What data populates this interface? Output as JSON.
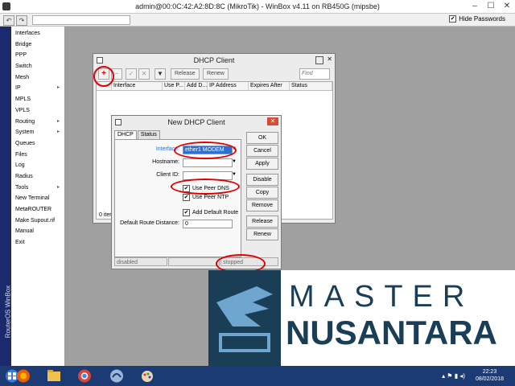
{
  "titlebar": {
    "title": "admin@00:0C:42:A2:8D:8C (MikroTik) - WinBox v4.11 on RB450G (mipsbe)",
    "minimize": "–",
    "maximize": "☐",
    "close": "✕"
  },
  "toolbar": {
    "undo": "↶",
    "redo": "↷",
    "hide_passwords_label": "Hide Passwords",
    "hide_passwords_checked": "✔"
  },
  "sidebar": {
    "brand_vertical": "RouterOS WinBox",
    "items": [
      {
        "label": "Interfaces",
        "arrow": ""
      },
      {
        "label": "Bridge",
        "arrow": ""
      },
      {
        "label": "PPP",
        "arrow": ""
      },
      {
        "label": "Switch",
        "arrow": ""
      },
      {
        "label": "Mesh",
        "arrow": ""
      },
      {
        "label": "IP",
        "arrow": "▸"
      },
      {
        "label": "MPLS",
        "arrow": ""
      },
      {
        "label": "VPLS",
        "arrow": ""
      },
      {
        "label": "Routing",
        "arrow": "▸"
      },
      {
        "label": "System",
        "arrow": "▸"
      },
      {
        "label": "Queues",
        "arrow": ""
      },
      {
        "label": "Files",
        "arrow": ""
      },
      {
        "label": "Log",
        "arrow": ""
      },
      {
        "label": "Radius",
        "arrow": ""
      },
      {
        "label": "Tools",
        "arrow": "▸"
      },
      {
        "label": "New Terminal",
        "arrow": ""
      },
      {
        "label": "MetaROUTER",
        "arrow": ""
      },
      {
        "label": "Make Supout.rif",
        "arrow": ""
      },
      {
        "label": "Manual",
        "arrow": ""
      },
      {
        "label": "Exit",
        "arrow": ""
      }
    ]
  },
  "dhcp_client": {
    "title": "DHCP Client",
    "add": "+",
    "remove": "−",
    "enable": "✓",
    "disable": "✕",
    "filter": "▼",
    "release": "Release",
    "renew": "Renew",
    "find_placeholder": "Find",
    "columns": [
      "Interface",
      "Use P...",
      "Add D...",
      "IP Address",
      "Expires After",
      "Status"
    ],
    "items_count": "0 item"
  },
  "new_dhcp_client": {
    "title": "New DHCP Client",
    "tabs": [
      "DHCP",
      "Status"
    ],
    "interface_label": "Interface:",
    "interface_value": "ether1 MODEM",
    "hostname_label": "Hostname:",
    "hostname_value": "",
    "client_id_label": "Client ID:",
    "client_id_value": "",
    "use_peer_dns": "Use Peer DNS",
    "use_peer_ntp": "Use Peer NTP",
    "add_default_route": "Add Default Route",
    "checked_mark": "✔",
    "default_route_distance_label": "Default Route Distance:",
    "default_route_distance_value": "0",
    "buttons": [
      "OK",
      "Cancel",
      "Apply",
      "Disable",
      "Copy",
      "Remove",
      "Release",
      "Renew"
    ],
    "status_left": "disabled",
    "status_mid": "",
    "status_right": "stopped"
  },
  "brand": {
    "top": "MASTER",
    "bottom": "NUSANTARA"
  },
  "taskbar": {
    "time": "22:23",
    "date": "08/02/2018",
    "tray": "▴  ⚑  ▮  ◂)"
  },
  "colors": {
    "annotation_red": "#e00000",
    "sidebar_strip": "#1a2a6c",
    "brand_blue": "#1b3e57",
    "selection_blue": "#2f6fd0",
    "taskbar": "#1c3a73"
  }
}
